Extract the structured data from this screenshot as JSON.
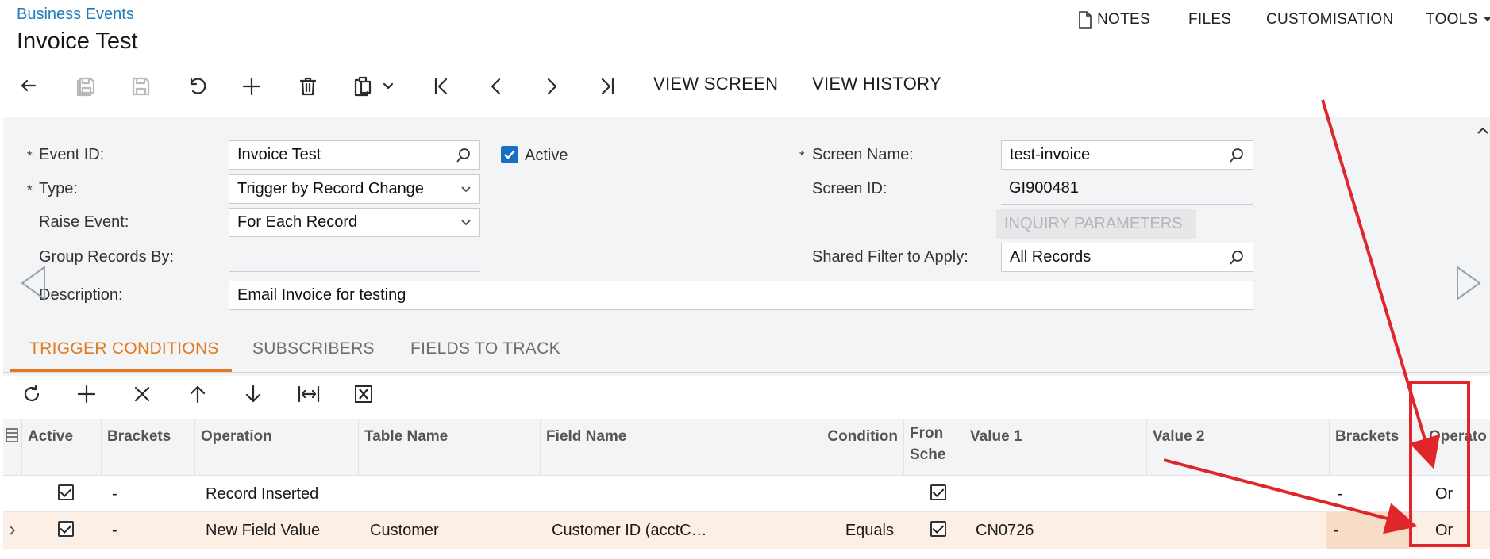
{
  "header": {
    "breadcrumb": "Business Events",
    "title": "Invoice Test",
    "menu": {
      "notes": "NOTES",
      "files": "FILES",
      "customisation": "CUSTOMISATION",
      "tools": "TOOLS"
    }
  },
  "toolbar": {
    "view_screen": "VIEW SCREEN",
    "view_history": "VIEW HISTORY"
  },
  "form": {
    "event_id": {
      "label": "Event ID:",
      "value": "Invoice Test"
    },
    "active": {
      "label": "Active",
      "checked": true
    },
    "type": {
      "label": "Type:",
      "value": "Trigger by Record Change"
    },
    "raise_event": {
      "label": "Raise Event:",
      "value": "For Each Record"
    },
    "group_records_by": {
      "label": "Group Records By:",
      "value": ""
    },
    "description": {
      "label": "Description:",
      "value": "Email Invoice for testing"
    },
    "screen_name": {
      "label": "Screen Name:",
      "value": "test-invoice"
    },
    "screen_id": {
      "label": "Screen ID:",
      "value": "GI900481"
    },
    "inquiry_parameters": "INQUIRY PARAMETERS",
    "shared_filter": {
      "label": "Shared Filter to Apply:",
      "value": "All Records"
    },
    "required_mark": "*"
  },
  "tabs": [
    {
      "label": "TRIGGER CONDITIONS",
      "active": true
    },
    {
      "label": "SUBSCRIBERS",
      "active": false
    },
    {
      "label": "FIELDS TO TRACK",
      "active": false
    }
  ],
  "grid": {
    "columns": {
      "active": "Active",
      "brackets_open": "Brackets",
      "operation": "Operation",
      "table_name": "Table Name",
      "field_name": "Field Name",
      "condition": "Condition",
      "from_schema_1": "Fron",
      "from_schema_2": "Sche",
      "value1": "Value 1",
      "value2": "Value 2",
      "brackets_close": "Brackets",
      "operator": "Operato"
    },
    "rows": [
      {
        "active": true,
        "brackets_open": "-",
        "operation": "Record Inserted",
        "table_name": "",
        "field_name": "",
        "condition": "",
        "from_schema": true,
        "value1": "",
        "value2": "",
        "brackets_close": "-",
        "operator": "Or"
      },
      {
        "active": true,
        "brackets_open": "-",
        "operation": "New Field Value",
        "table_name": "Customer",
        "field_name": "Customer ID (acctC…",
        "condition": "Equals",
        "from_schema": true,
        "value1": "CN0726",
        "value2": "",
        "brackets_close": "-",
        "operator": "Or"
      }
    ]
  },
  "colors": {
    "accent_orange": "#e07a1f",
    "link_blue": "#1f7bbd",
    "annotation_red": "#e0262a",
    "selected_row": "#fcefe6",
    "checkbox_blue": "#1b6fc2"
  }
}
